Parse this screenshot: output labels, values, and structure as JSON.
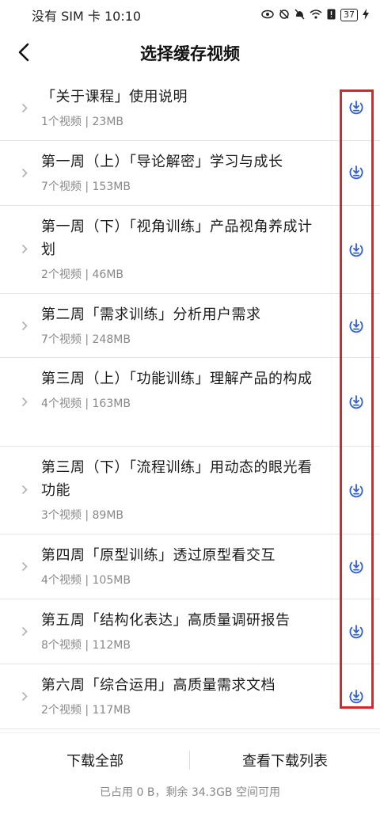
{
  "status_bar": {
    "carrier": "没有 SIM 卡",
    "time": "10:10",
    "battery": "37"
  },
  "header": {
    "title": "选择缓存视频"
  },
  "courses": [
    {
      "title": "「关于课程」使用说明",
      "meta": "1个视频 | 23MB"
    },
    {
      "title": "第一周（上）「导论解密」学习与成长",
      "meta": "7个视频 | 153MB"
    },
    {
      "title": "第一周（下）「视角训练」产品视角养成计划",
      "meta": "2个视频 | 46MB"
    },
    {
      "title": "第二周「需求训练」分析用户需求",
      "meta": "7个视频 | 248MB"
    },
    {
      "title": "第三周（上）「功能训练」理解产品的构成",
      "meta": "4个视频 | 163MB"
    },
    {
      "title": "第三周（下）「流程训练」用动态的眼光看功能",
      "meta": "3个视频 | 89MB"
    },
    {
      "title": "第四周「原型训练」透过原型看交互",
      "meta": "4个视频 | 105MB"
    },
    {
      "title": "第五周「结构化表达」高质量调研报告",
      "meta": "8个视频 | 112MB"
    },
    {
      "title": "第六周「综合运用」高质量需求文档",
      "meta": "2个视频 | 117MB"
    }
  ],
  "bottom": {
    "download_all": "下载全部",
    "view_list": "查看下载列表",
    "storage": "已占用 0 B，剩余 34.3GB 空间可用"
  },
  "colors": {
    "accent": "#2f5fd0",
    "highlight": "#d9262c"
  },
  "icons": {
    "back": "chevron-left-icon",
    "row_expand": "chevron-right-icon",
    "download": "download-circle-icon"
  }
}
